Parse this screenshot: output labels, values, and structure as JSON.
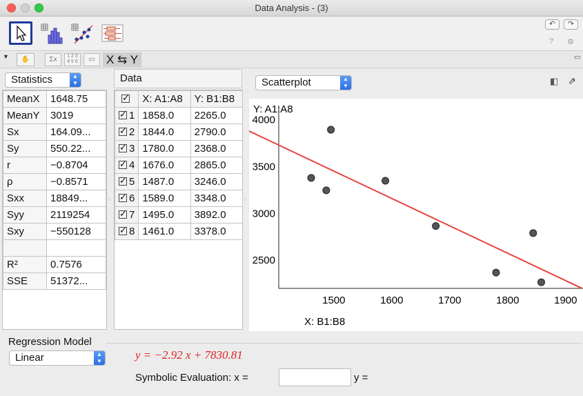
{
  "window": {
    "title": "Data Analysis - (3)"
  },
  "toolbar": {
    "tools": [
      "move-tool",
      "histogram-tool",
      "scatterplot-tool",
      "boxplot-tool"
    ],
    "undo_icon": "undo-icon",
    "redo_icon": "redo-icon",
    "help_icon": "help-icon",
    "settings_icon": "gear-icon",
    "swap_label": "X ⇆ Y"
  },
  "stats": {
    "dropdown": "Statistics",
    "rows": [
      {
        "label": "MeanX",
        "value": "1648.75"
      },
      {
        "label": "MeanY",
        "value": "3019"
      },
      {
        "label": "Sx",
        "value": "164.09..."
      },
      {
        "label": "Sy",
        "value": "550.22..."
      },
      {
        "label": "r",
        "value": "−0.8704"
      },
      {
        "label": "ρ",
        "value": "−0.8571"
      },
      {
        "label": "Sxx",
        "value": "18849..."
      },
      {
        "label": "Syy",
        "value": "2119254"
      },
      {
        "label": "Sxy",
        "value": "−550128"
      },
      {
        "label": "",
        "value": ""
      },
      {
        "label": "R²",
        "value": "0.7576"
      },
      {
        "label": "SSE",
        "value": "51372..."
      }
    ]
  },
  "data": {
    "title": "Data",
    "col_x": "X: A1:A8",
    "col_y": "Y: B1:B8",
    "rows": [
      {
        "n": "1",
        "x": "1858.0",
        "y": "2265.0"
      },
      {
        "n": "2",
        "x": "1844.0",
        "y": "2790.0"
      },
      {
        "n": "3",
        "x": "1780.0",
        "y": "2368.0"
      },
      {
        "n": "4",
        "x": "1676.0",
        "y": "2865.0"
      },
      {
        "n": "5",
        "x": "1487.0",
        "y": "3246.0"
      },
      {
        "n": "6",
        "x": "1589.0",
        "y": "3348.0"
      },
      {
        "n": "7",
        "x": "1495.0",
        "y": "3892.0"
      },
      {
        "n": "8",
        "x": "1461.0",
        "y": "3378.0"
      }
    ]
  },
  "plot": {
    "dropdown": "Scatterplot",
    "ylabel": "Y:  A1:A8",
    "xlabel": "X:  B1:B8",
    "line_color": "#e8413a",
    "point_color": "#555555"
  },
  "chart_data": {
    "type": "scatter",
    "x": [
      1858,
      1844,
      1780,
      1676,
      1487,
      1589,
      1495,
      1461
    ],
    "y": [
      2265,
      2790,
      2368,
      2865,
      3246,
      3348,
      3892,
      3378
    ],
    "xticks": [
      "1500",
      "1600",
      "1700",
      "1800",
      "1900"
    ],
    "yticks": [
      "2500",
      "3000",
      "3500",
      "4000"
    ],
    "xlim": [
      1405,
      1930
    ],
    "ylim": [
      2200,
      4150
    ],
    "regression": {
      "slope": -2.92,
      "intercept": 7830.81
    },
    "grid": false
  },
  "regression": {
    "title": "Regression Model",
    "model": "Linear",
    "equation": "y = −2.92 x + 7830.81",
    "symbolic_label": "Symbolic Evaluation:  x =",
    "y_label": "y =",
    "x_input": ""
  }
}
